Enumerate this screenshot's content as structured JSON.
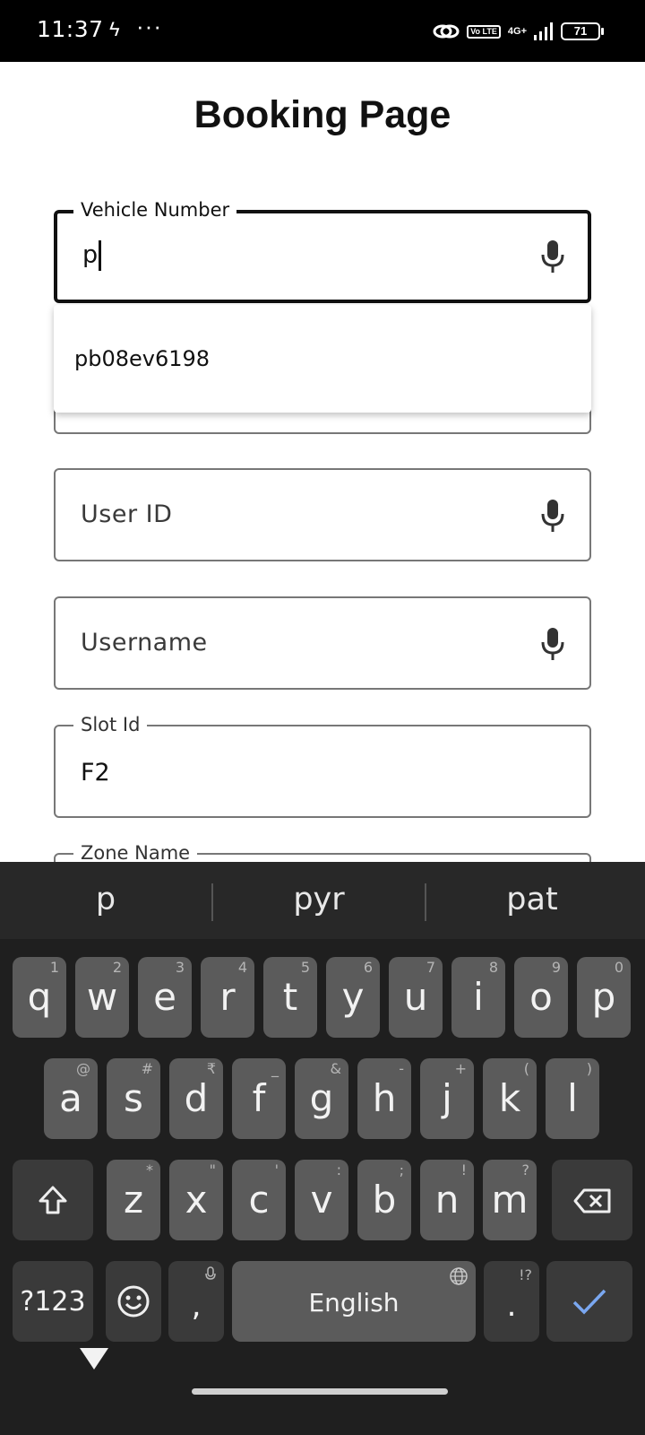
{
  "status_bar": {
    "time": "11:37",
    "volte": "Vo LTE",
    "network": "4G+",
    "battery": "71"
  },
  "page": {
    "title": "Booking Page"
  },
  "fields": {
    "vehicle_number": {
      "label": "Vehicle Number",
      "value": "p"
    },
    "user_id": {
      "placeholder": "User ID"
    },
    "username": {
      "placeholder": "Username"
    },
    "slot_id": {
      "label": "Slot Id",
      "value": "F2"
    },
    "zone_name": {
      "label": "Zone Name"
    }
  },
  "autocomplete": {
    "items": [
      "pb08ev6198"
    ]
  },
  "keyboard": {
    "suggestions": [
      "p",
      "pyr",
      "pat"
    ],
    "row1": [
      {
        "key": "q",
        "hint": "1"
      },
      {
        "key": "w",
        "hint": "2"
      },
      {
        "key": "e",
        "hint": "3"
      },
      {
        "key": "r",
        "hint": "4"
      },
      {
        "key": "t",
        "hint": "5"
      },
      {
        "key": "y",
        "hint": "6"
      },
      {
        "key": "u",
        "hint": "7"
      },
      {
        "key": "i",
        "hint": "8"
      },
      {
        "key": "o",
        "hint": "9"
      },
      {
        "key": "p",
        "hint": "0"
      }
    ],
    "row2": [
      {
        "key": "a",
        "hint": "@"
      },
      {
        "key": "s",
        "hint": "#"
      },
      {
        "key": "d",
        "hint": "₹"
      },
      {
        "key": "f",
        "hint": "_"
      },
      {
        "key": "g",
        "hint": "&"
      },
      {
        "key": "h",
        "hint": "-"
      },
      {
        "key": "j",
        "hint": "+"
      },
      {
        "key": "k",
        "hint": "("
      },
      {
        "key": "l",
        "hint": ")"
      }
    ],
    "row3": [
      {
        "key": "z",
        "hint": "*"
      },
      {
        "key": "x",
        "hint": "\""
      },
      {
        "key": "c",
        "hint": "'"
      },
      {
        "key": "v",
        "hint": ":"
      },
      {
        "key": "b",
        "hint": ";"
      },
      {
        "key": "n",
        "hint": "!"
      },
      {
        "key": "m",
        "hint": "?"
      }
    ],
    "symbols_label": "?123",
    "comma": ",",
    "space_label": "English",
    "period": ".",
    "period_hint": "!?"
  },
  "colors": {
    "keyboard_bg": "#1f1f1f",
    "key_bg": "#5b5b5b",
    "key_dark_bg": "#3a3a3a",
    "enter_accent": "#7aa7f0"
  }
}
